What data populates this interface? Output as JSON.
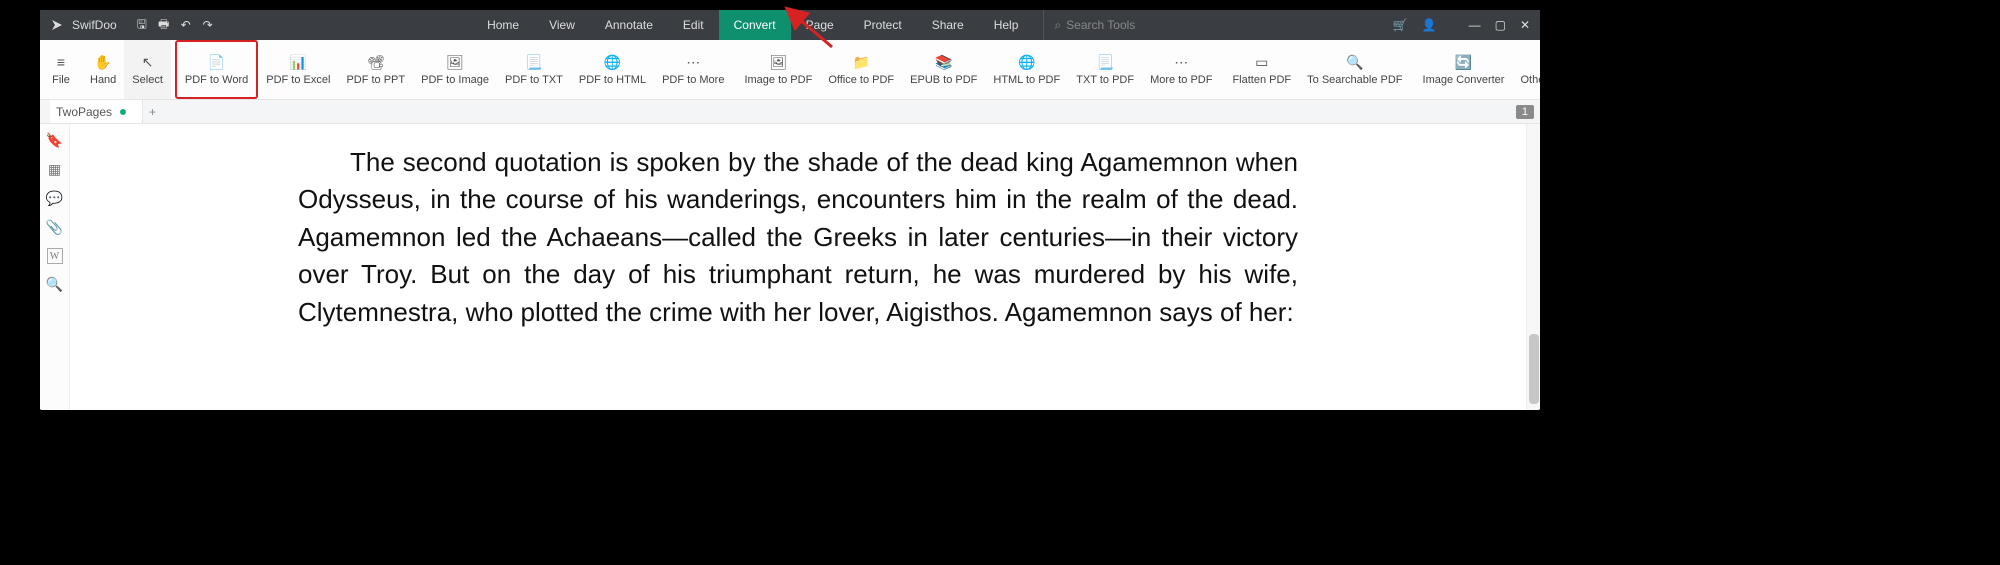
{
  "app_name": "SwifDoo",
  "menu": {
    "items": [
      "Home",
      "View",
      "Annotate",
      "Edit",
      "Convert",
      "Page",
      "Protect",
      "Share",
      "Help"
    ],
    "active": "Convert",
    "search_placeholder": "Search Tools"
  },
  "ribbon": {
    "file": "File",
    "hand": "Hand",
    "select": "Select",
    "pdf_to_word": "PDF to Word",
    "pdf_to_excel": "PDF to Excel",
    "pdf_to_ppt": "PDF to PPT",
    "pdf_to_image": "PDF to Image",
    "pdf_to_txt": "PDF to TXT",
    "pdf_to_html": "PDF to HTML",
    "pdf_to_more": "PDF to More",
    "image_to_pdf": "Image to PDF",
    "office_to_pdf": "Office to PDF",
    "epub_to_pdf": "EPUB to PDF",
    "html_to_pdf": "HTML to PDF",
    "txt_to_pdf": "TXT to PDF",
    "more_to_pdf": "More to PDF",
    "flatten_pdf": "Flatten PDF",
    "to_searchable_pdf": "To Searchable PDF",
    "image_converter": "Image Converter",
    "other_features": "Other Features"
  },
  "doc": {
    "tab_name": "TwoPages",
    "page_indicator": "1",
    "body": "The second quotation is spoken by the shade of the dead king Agamemnon when Odysseus, in the course of his wanderings, encounters him in the realm of the dead. Agamemnon led the Achaeans—called the Greeks in later centuries—in their victory over Troy. But on the day of his triumphant return, he was murdered by his wife, Clytemnestra, who plotted the crime with her lover, Aigisthos. Agamemnon says of her:"
  },
  "icons": {
    "logo": "➤",
    "save": "🖫",
    "print": "🖶",
    "undo": "↶",
    "redo": "↷",
    "cart": "🛒",
    "user": "👤",
    "min": "—",
    "max": "▢",
    "close": "✕",
    "search": "⌕",
    "bookmark": "🔖",
    "thumbnails": "▦",
    "comment": "💬",
    "attach": "📎",
    "word": "W",
    "find": "🔍",
    "plus": "+",
    "arrow_cursor": "↖",
    "hand_cursor": "✋",
    "file_icon": "≡"
  }
}
